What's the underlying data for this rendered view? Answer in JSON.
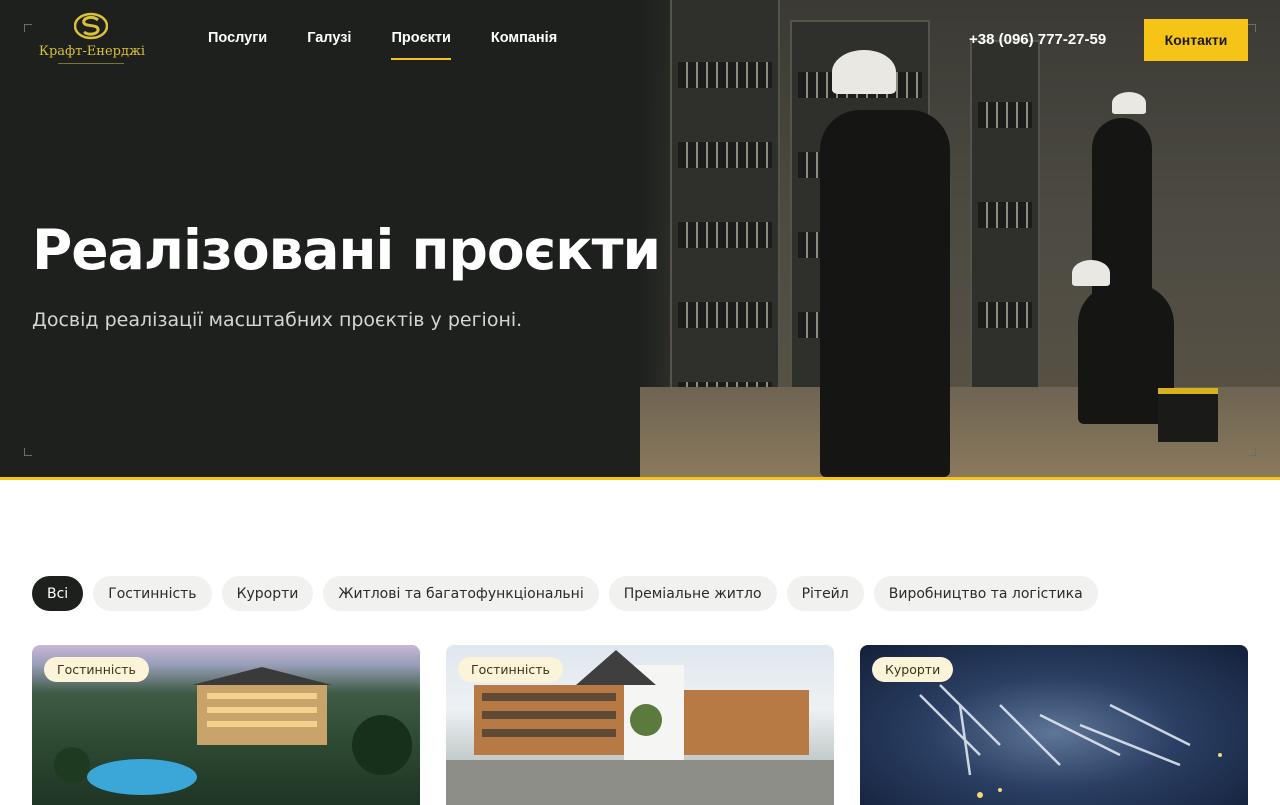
{
  "brand": {
    "name": "Крафт-Енерджі"
  },
  "nav": {
    "items": [
      {
        "label": "Послуги",
        "active": false
      },
      {
        "label": "Галузі",
        "active": false
      },
      {
        "label": "Проєкти",
        "active": true
      },
      {
        "label": "Компанія",
        "active": false
      }
    ]
  },
  "header": {
    "phone": "+38 (096) 777-27-59",
    "contact_label": "Контакти"
  },
  "hero": {
    "title": "Реалізовані проєкти",
    "subtitle": "Досвід реалізації масштабних проєктів у регіоні."
  },
  "filters": [
    {
      "label": "Всі",
      "active": true
    },
    {
      "label": "Гостинність",
      "active": false
    },
    {
      "label": "Курорти",
      "active": false
    },
    {
      "label": "Житлові та багатофункціональні",
      "active": false
    },
    {
      "label": "Преміальне житло",
      "active": false
    },
    {
      "label": "Рітейл",
      "active": false
    },
    {
      "label": "Виробництво та логістика",
      "active": false
    }
  ],
  "projects": [
    {
      "category": "Гостинність"
    },
    {
      "category": "Гостинність"
    },
    {
      "category": "Курорти"
    }
  ],
  "colors": {
    "accent": "#f6c417",
    "dark": "#1d201d",
    "chip_bg": "#f1f2ef",
    "badge_bg": "#fbf4d9"
  }
}
